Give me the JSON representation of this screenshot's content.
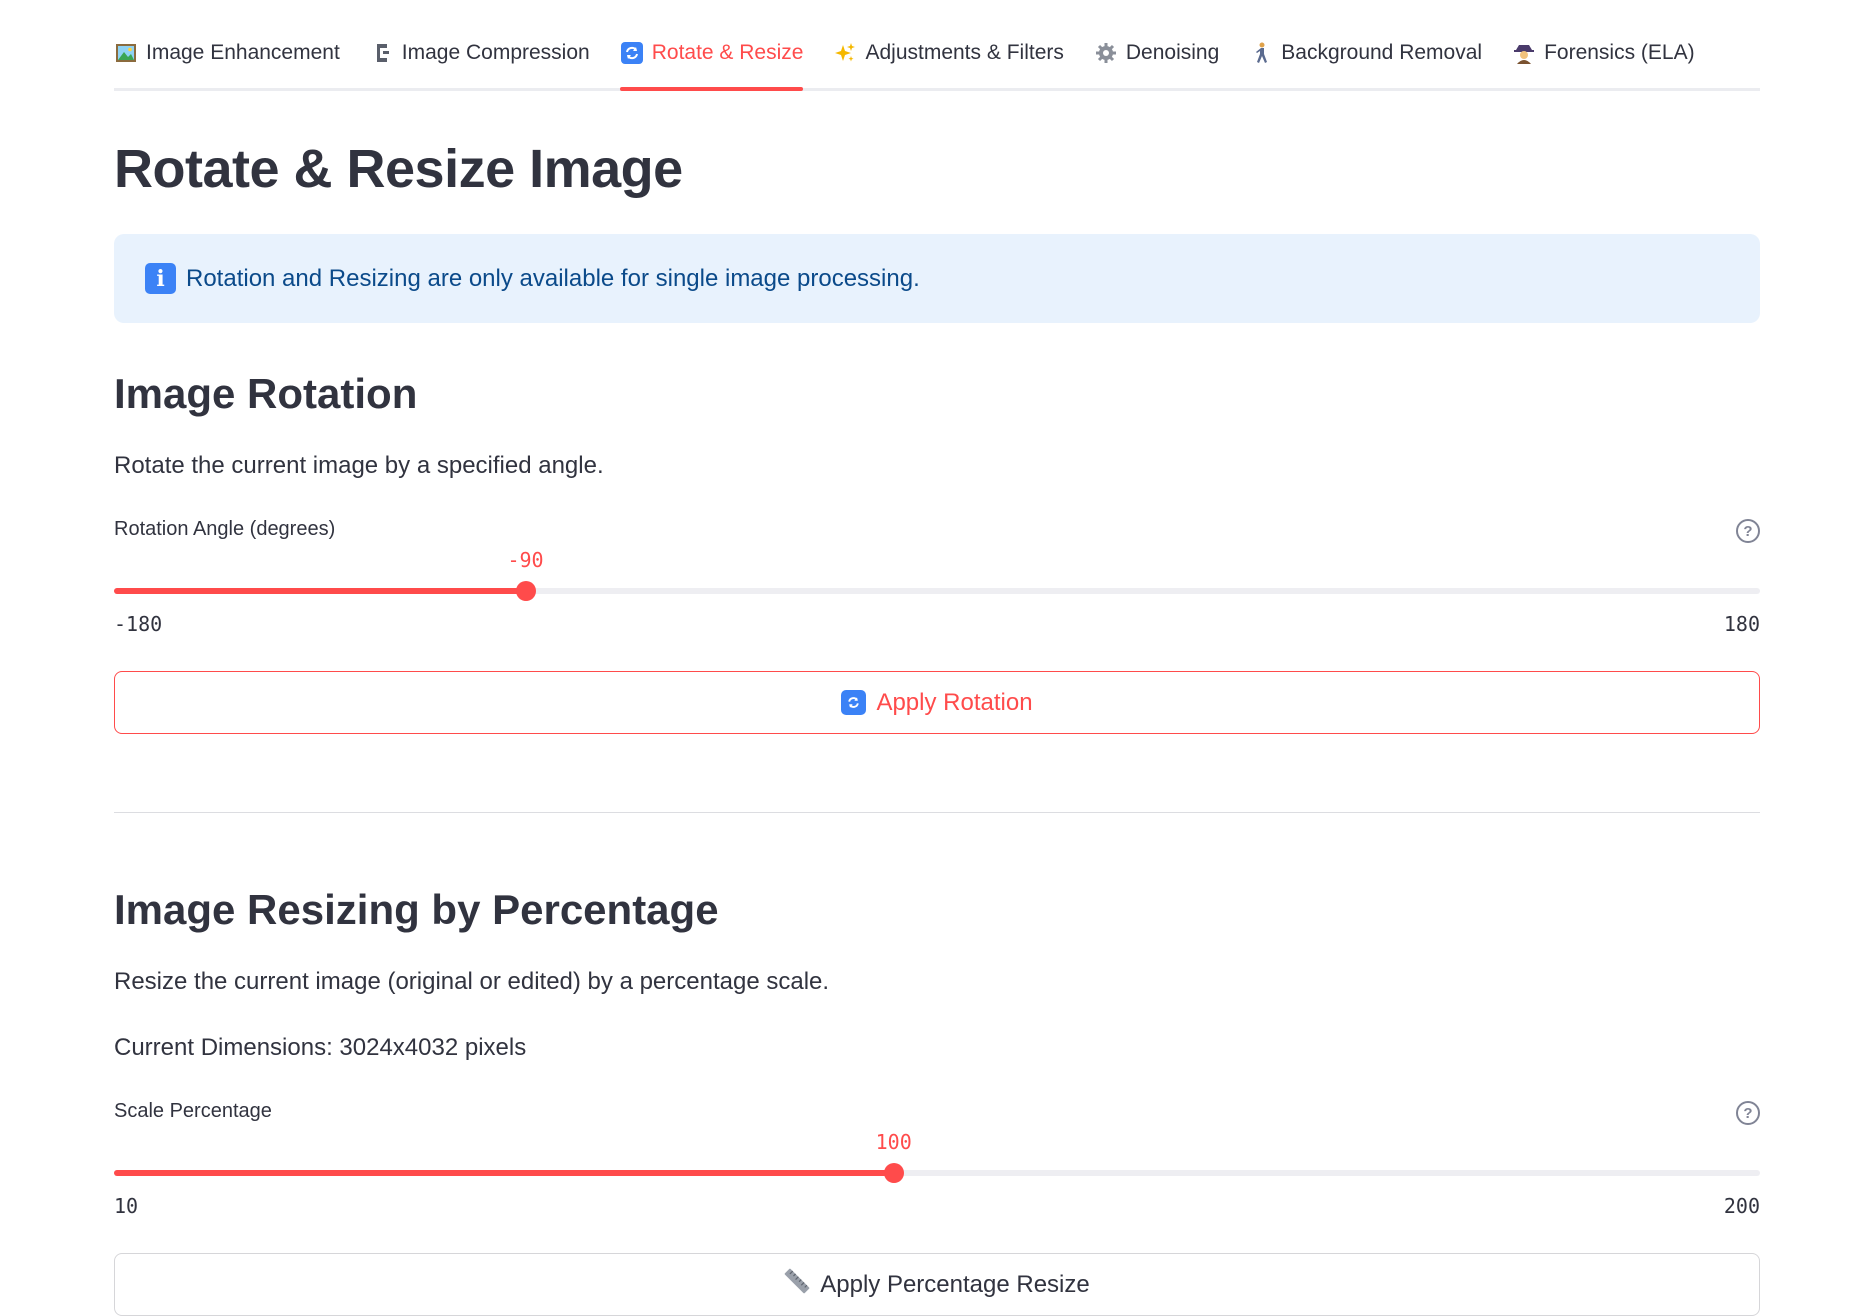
{
  "tabs": [
    {
      "icon": "framed-picture-icon",
      "label": "Image Enhancement",
      "active": false
    },
    {
      "icon": "clamp-icon",
      "label": "Image Compression",
      "active": false
    },
    {
      "icon": "rotate-icon",
      "label": "Rotate & Resize",
      "active": true
    },
    {
      "icon": "sparkles-icon",
      "label": "Adjustments & Filters",
      "active": false
    },
    {
      "icon": "gear-icon",
      "label": "Denoising",
      "active": false
    },
    {
      "icon": "person-walking-icon",
      "label": "Background Removal",
      "active": false
    },
    {
      "icon": "detective-icon",
      "label": "Forensics (ELA)",
      "active": false
    }
  ],
  "page_title": "Rotate & Resize Image",
  "info_message": "Rotation and Resizing are only available for single image processing.",
  "rotation": {
    "heading": "Image Rotation",
    "description": "Rotate the current image by a specified angle.",
    "slider_label": "Rotation Angle (degrees)",
    "value": "-90",
    "min": "-180",
    "max": "180",
    "button_label": "Apply Rotation"
  },
  "resize": {
    "heading": "Image Resizing by Percentage",
    "description": "Resize the current image (original or edited) by a percentage scale.",
    "current_dimensions": "Current Dimensions: 3024x4032 pixels",
    "slider_label": "Scale Percentage",
    "value": "100",
    "min": "10",
    "max": "200",
    "button_label": "Apply Percentage Resize"
  },
  "colors": {
    "accent": "#ff4b4b",
    "info_bg": "#e8f2fd",
    "info_text": "#0b4a8a",
    "text": "#31333f"
  }
}
